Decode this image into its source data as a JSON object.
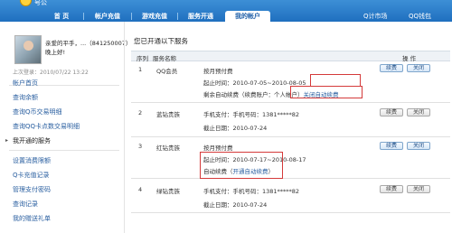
{
  "topnav": {
    "logo_text": "号公",
    "tabs": [
      {
        "label": "首 页"
      },
      {
        "label": "帐户充值"
      },
      {
        "label": "游戏充值"
      },
      {
        "label": "服务开通"
      },
      {
        "label": "我的帐户"
      }
    ],
    "active_tab": "我的帐户",
    "right_links": [
      "Q计市场",
      "QQ钱包"
    ]
  },
  "user": {
    "line1": "亲爱的平手，...（841250007）",
    "line2": "晚上好!",
    "last_login": "上次登录：2010/07/22 13:22"
  },
  "sidebar": {
    "group1": [
      "帐户首页",
      "查询余额",
      "查询Q币交易明细",
      "查询QQ卡点数交易明细",
      "我开通的服务"
    ],
    "active_item": "我开通的服务",
    "group2": [
      "设置消费限额",
      "Q卡充值记录",
      "管理支付密码",
      "查询记录",
      "我的赠送礼单"
    ]
  },
  "main": {
    "title": "您已开通以下服务",
    "columns": {
      "index": "序列",
      "name": "服务名称",
      "info": "",
      "ops": "操 作"
    },
    "rows": [
      {
        "index": "1",
        "name": "QQ会员",
        "line1": "按月预付费",
        "line2": "起止时间：2010-07-05~2010-08-05",
        "line3_prefix": "剩余自动续费（续费账户：个人帐户）",
        "line3_link": "关闭自动续费",
        "btn1": "续费",
        "btn2": "关闭"
      },
      {
        "index": "2",
        "name": "蓝钻贵族",
        "line1": "手机支付：手机号码：1381*****82",
        "line2": "截止日期：2010-07-24",
        "btn1": "续费",
        "btn2": "关闭"
      },
      {
        "index": "3",
        "name": "红钻贵族",
        "line1": "按月预付费",
        "line2": "起止时间：2010-07-17~2010-08-17",
        "line3_prefix": "自动续费（",
        "line3_link": "开通自动续费",
        "line3_suffix": "）",
        "btn1": "续费",
        "btn2": "关闭"
      },
      {
        "index": "4",
        "name": "绿钻贵族",
        "line1": "手机支付：手机号码：1381*****82",
        "line2": "截止日期：2010-07-24",
        "btn1": "续费",
        "btn2": "关闭"
      }
    ]
  },
  "colors": {
    "nav_blue": "#1f6fbf",
    "link_blue": "#2a5fa0",
    "highlight_red": "#d43a3a"
  }
}
